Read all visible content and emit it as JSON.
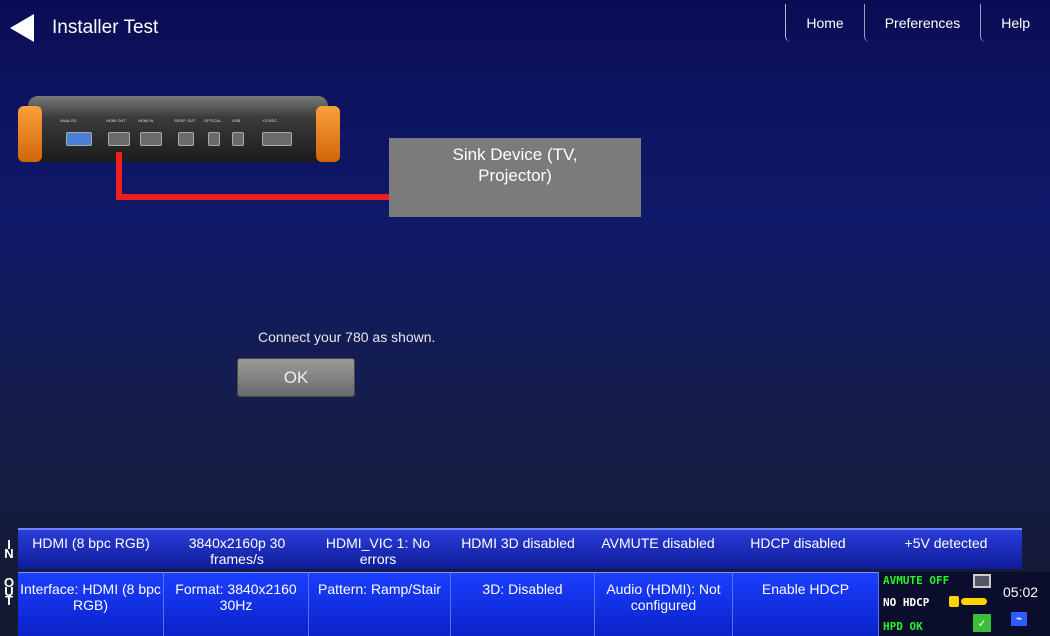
{
  "header": {
    "title": "Installer Test",
    "nav": [
      "Home",
      "Preferences",
      "Help"
    ]
  },
  "diagram": {
    "sink_label": "Sink Device (TV, Projector)",
    "port_labels": [
      "ANALOG",
      "HDMI OUT",
      "HDMI IN",
      "SPDIF OUT",
      "OPTICAL",
      "USB",
      "+12VDC"
    ],
    "cable_color": "#ee1f1f",
    "bumper_color": "#f08a1f"
  },
  "prompt": {
    "message": "Connect your 780 as shown.",
    "ok_label": "OK"
  },
  "input_status": {
    "label": "IN",
    "cells": [
      "HDMI (8 bpc RGB)",
      "3840x2160p 30 frames/s",
      "HDMI_VIC 1: No errors",
      "HDMI 3D disabled",
      "AVMUTE disabled",
      "HDCP disabled",
      "+5V detected"
    ]
  },
  "output_status": {
    "label": "OUT",
    "buttons": [
      "Interface: HDMI (8 bpc RGB)",
      "Format: 3840x2160 30Hz",
      "Pattern: Ramp/Stair",
      "3D: Disabled",
      "Audio (HDMI): Not configured",
      "Enable HDCP"
    ],
    "indicators": {
      "avmute": "AVMUTE OFF",
      "hdcp": "NO HDCP",
      "hpd": "HPD OK"
    },
    "time": "05:02",
    "accent_green": "#27f227"
  }
}
